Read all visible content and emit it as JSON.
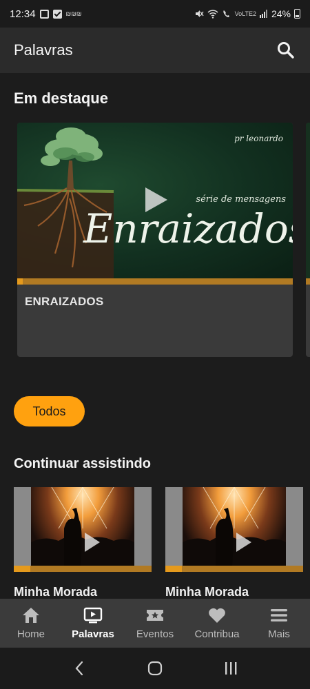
{
  "status_bar": {
    "time": "12:34",
    "small_text": "₪₪₪",
    "network_label": "VoLTE2",
    "battery": "24%"
  },
  "app_bar": {
    "title": "Palavras",
    "search_icon": "search-icon"
  },
  "featured": {
    "section_title": "Em destaque",
    "items": [
      {
        "title": "ENRAIZADOS",
        "thumbnail_text": {
          "author": "pr leonardo",
          "subtitle": "série de mensagens",
          "headline": "Enraizados"
        },
        "progress": 0.02
      }
    ]
  },
  "filter": {
    "chip_label": "Todos"
  },
  "continue_watching": {
    "section_title": "Continuar assistindo",
    "items": [
      {
        "title": "Minha Morada",
        "progress": 0.12
      },
      {
        "title": "Minha Morada",
        "progress": 0.12
      }
    ]
  },
  "bottom_nav": {
    "items": [
      {
        "label": "Home",
        "icon": "home-icon",
        "active": false
      },
      {
        "label": "Palavras",
        "icon": "tv-play-icon",
        "active": true
      },
      {
        "label": "Eventos",
        "icon": "ticket-star-icon",
        "active": false
      },
      {
        "label": "Contribua",
        "icon": "heart-icon",
        "active": false
      },
      {
        "label": "Mais",
        "icon": "menu-icon",
        "active": false
      }
    ]
  },
  "colors": {
    "accent": "#ffa10f",
    "progress_fill": "#e59a1d",
    "progress_track": "#b17a23",
    "background": "#1c1c1c",
    "app_bar": "#2b2b2b",
    "nav_bar": "#3b3b3b"
  }
}
